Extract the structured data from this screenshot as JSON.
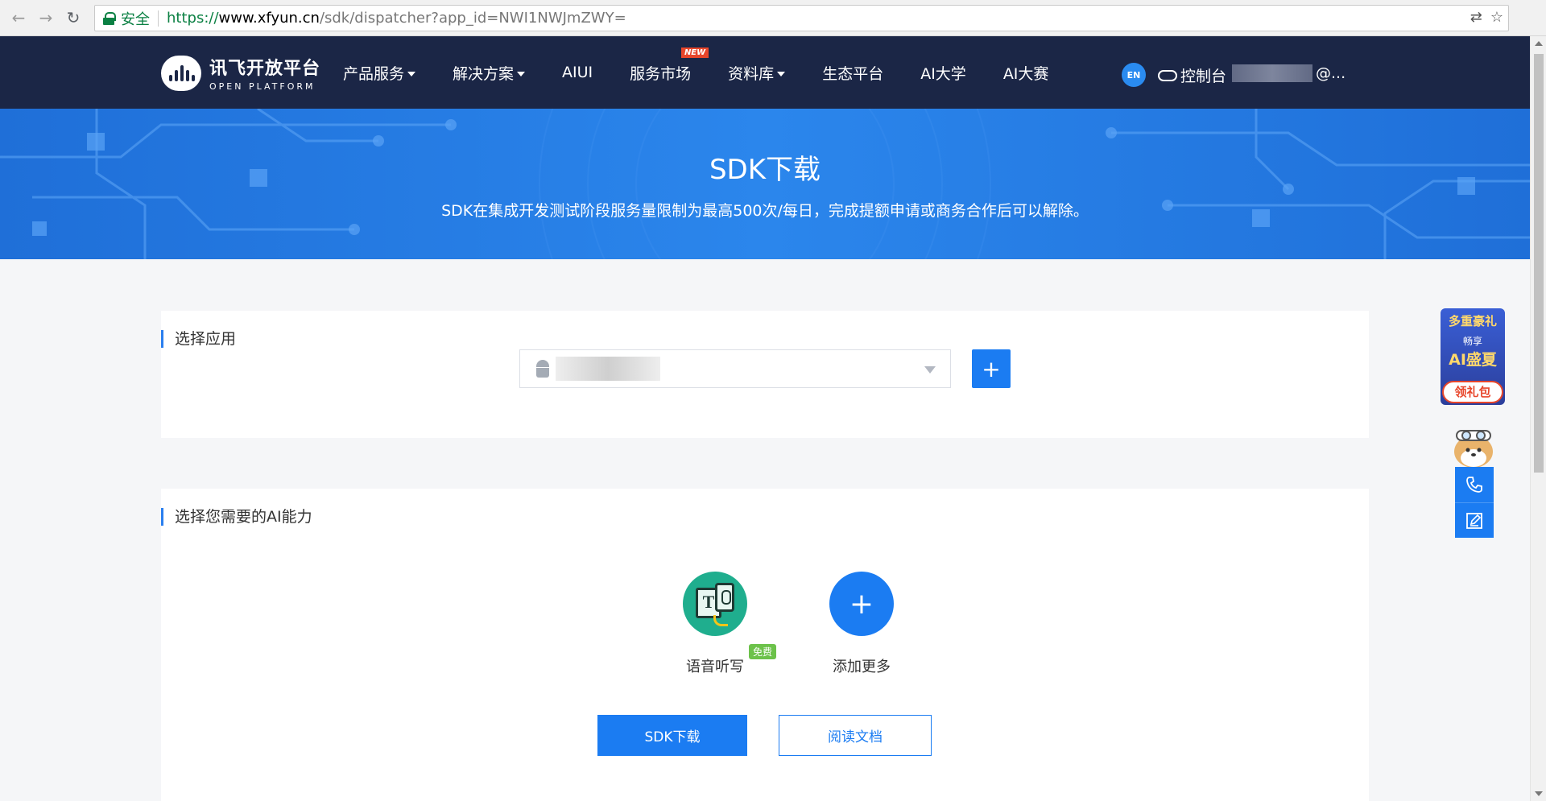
{
  "browser": {
    "back": "←",
    "forward": "→",
    "reload": "↻",
    "secure_label": "安全",
    "url_scheme": "https://",
    "url_host": "www.xfyun.cn",
    "url_path": "/sdk/dispatcher?app_id=NWI1NWJmZWY=",
    "translate_icon": "⇄",
    "star_icon": "☆"
  },
  "header": {
    "logo_cn": "讯飞开放平台",
    "logo_en": "OPEN PLATFORM",
    "nav": [
      {
        "label": "产品服务",
        "dropdown": true
      },
      {
        "label": "解决方案",
        "dropdown": true
      },
      {
        "label": "AIUI",
        "dropdown": false
      },
      {
        "label": "服务市场",
        "dropdown": false,
        "badge": "NEW"
      },
      {
        "label": "资料库",
        "dropdown": true
      },
      {
        "label": "生态平台",
        "dropdown": false
      },
      {
        "label": "AI大学",
        "dropdown": false
      },
      {
        "label": "AI大赛",
        "dropdown": false
      }
    ],
    "lang_label": "EN",
    "console_label": "控制台",
    "user_suffix": "@..."
  },
  "banner": {
    "title": "SDK下载",
    "subtitle": "SDK在集成开发测试阶段服务量限制为最高500次/每日，完成提额申请或商务合作后可以解除。"
  },
  "app_section": {
    "title": "选择应用",
    "add_label": "+"
  },
  "ai_section": {
    "title": "选择您需要的AI能力",
    "abilities": [
      {
        "label": "语音听写",
        "badge": "免费",
        "icon": "speech-dictation-icon"
      },
      {
        "label": "添加更多",
        "icon": "plus-icon"
      }
    ],
    "download_button": "SDK下载",
    "docs_button": "阅读文档"
  },
  "promo": {
    "line1": "多重豪礼",
    "line2": "畅享",
    "line3": "AI盛夏",
    "cta": "领礼包"
  },
  "colors": {
    "header_bg": "#1b2646",
    "accent": "#1b7cf2",
    "banner": "#2b86ec",
    "free_badge": "#6cc24a",
    "new_badge": "#e8462b"
  }
}
